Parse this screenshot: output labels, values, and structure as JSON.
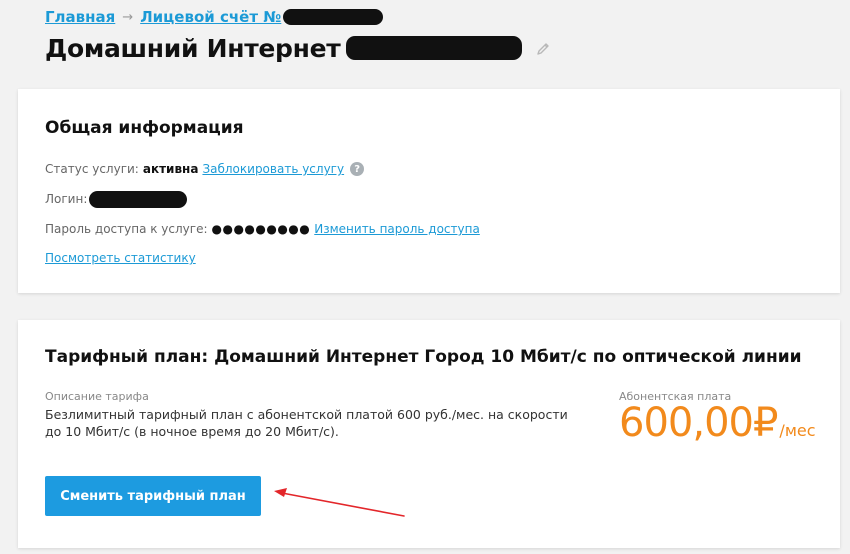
{
  "breadcrumb": {
    "home": "Главная",
    "separator": "→",
    "account": "Лицевой счёт №"
  },
  "page": {
    "title": "Домашний Интернет"
  },
  "info": {
    "title": "Общая информация",
    "status_label": "Статус услуги:",
    "status_value": "активна",
    "block_link": "Заблокировать услугу",
    "help_glyph": "?",
    "login_label": "Логин:",
    "password_label": "Пароль доступа к услуге:",
    "password_mask": "●●●●●●●●●",
    "change_password_link": "Изменить пароль доступа",
    "stats_link": "Посмотреть статистику"
  },
  "tariff": {
    "title": "Тарифный план: Домашний Интернет Город 10 Мбит/с по оптической линии",
    "desc_label": "Описание тарифа",
    "desc_text": "Безлимитный тарифный план с абонентской платой 600 руб./мес. на скорости до 10 Мбит/с (в ночное время до 20 Мбит/с).",
    "fee_label": "Абонентская плата",
    "fee_amount": "600,00₽",
    "fee_unit": "/мес",
    "change_button": "Сменить тарифный план"
  },
  "colors": {
    "link": "#1c9ad6",
    "button": "#1d9be0",
    "price": "#f28a1c",
    "annotation_arrow": "#e3262a",
    "background": "#f2f2f2"
  },
  "icons": {
    "edit": "pencil-icon",
    "help": "question-circle-icon",
    "breadcrumb_separator": "arrow-right-icon"
  }
}
